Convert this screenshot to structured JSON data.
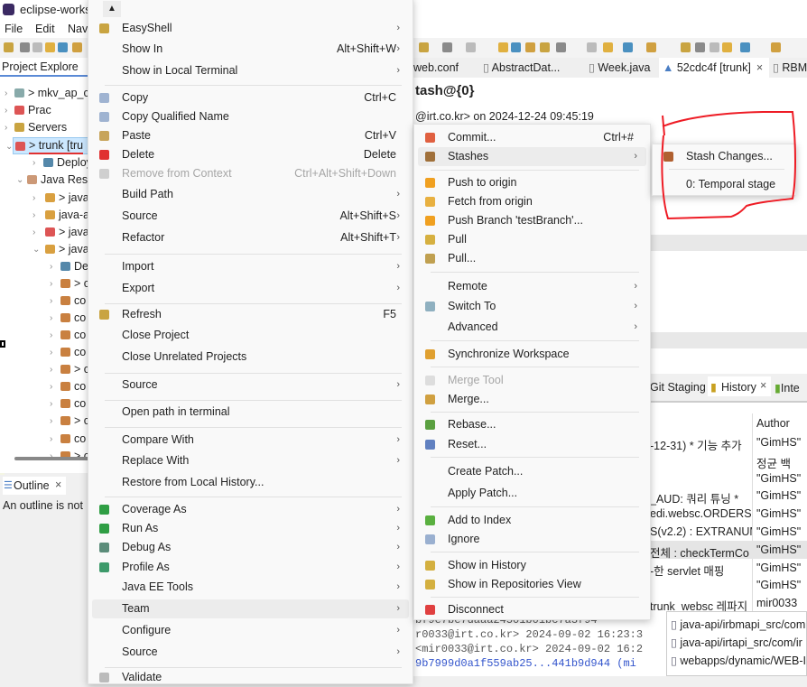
{
  "window": {
    "title": "eclipse-works"
  },
  "menubar": [
    "File",
    "Edit",
    "Nav"
  ],
  "project_explorer": {
    "tab": "Project Explore",
    "rows": [
      "> mkv_ap_c",
      "Prac",
      "Servers",
      "> trunk [tru",
      "Deploym",
      "Java Reso",
      "> java",
      "java-a",
      "> java",
      "> java",
      "De",
      "> c",
      "co",
      "co",
      "co",
      "co",
      "> c",
      "co",
      "co",
      "> c",
      "co",
      "> c"
    ]
  },
  "outline": {
    "tab": "Outline",
    "message": "An outline is not"
  },
  "editor": {
    "tabs": [
      "web.conf",
      "AbstractDat...",
      "Week.java",
      "52cdc4f [trunk]",
      "RBMT"
    ],
    "title": "tash@{0}",
    "author_line": "@irt.co.kr> on 2024-12-24 09:45:19"
  },
  "history": {
    "tabs": [
      "Git Staging",
      "History",
      "Inte"
    ],
    "author_header": "Author",
    "rows": [
      {
        "msg": "-12-31)  * 기능 추가",
        "author": "\"GimHS\""
      },
      {
        "msg": "",
        "author": "정균 백"
      },
      {
        "msg": "",
        "author": "\"GimHS\""
      },
      {
        "msg": "_AUD: 쿼리 튜닝   *",
        "author": "\"GimHS\""
      },
      {
        "msg": "edi.websc.ORDERSF",
        "author": "\"GimHS\""
      },
      {
        "msg": "S(v2.2) : EXTRANUM",
        "author": "\"GimHS\""
      },
      {
        "msg": "전체 : checkTermCo",
        "author": "\"GimHS\""
      },
      {
        "msg": "-한 servlet 매핑",
        "author": "\"GimHS\""
      },
      {
        "msg": "",
        "author": "\"GimHS\""
      },
      {
        "msg": "trunk_websc 레파지",
        "author": "mir0033"
      }
    ],
    "commit_text": [
      "bf9e7be7daaa24501b01bc7a3f94",
      "r0033@irt.co.kr> 2024-09-02 16:23:3",
      "<mir0033@irt.co.kr> 2024-09-02 16:2",
      "9b7999d0a1f559ab25...441b9d944 (mi"
    ],
    "files": [
      "java-api/irbmapi_src/com",
      "java-api/irtapi_src/com/ir",
      "webapps/dynamic/WEB-I"
    ]
  },
  "context_menu": {
    "items": [
      {
        "label": "EasyShell",
        "sub": true,
        "icon": "easyshell"
      },
      {
        "label": "Show In",
        "shortcut": "Alt+Shift+W",
        "sub": true
      },
      {
        "label": "Show in Local Terminal",
        "sub": true
      },
      {
        "label": "Copy",
        "shortcut": "Ctrl+C",
        "icon": "copy"
      },
      {
        "label": "Copy Qualified Name",
        "icon": "copy-qualified"
      },
      {
        "label": "Paste",
        "shortcut": "Ctrl+V",
        "icon": "paste"
      },
      {
        "label": "Delete",
        "shortcut": "Delete",
        "icon": "delete"
      },
      {
        "label": "Remove from Context",
        "shortcut": "Ctrl+Alt+Shift+Down",
        "icon": "remove-context",
        "disabled": true
      },
      {
        "label": "Build Path",
        "sub": true
      },
      {
        "label": "Source",
        "shortcut": "Alt+Shift+S",
        "sub": true
      },
      {
        "label": "Refactor",
        "shortcut": "Alt+Shift+T",
        "sub": true
      },
      {
        "label": "Import",
        "sub": true
      },
      {
        "label": "Export",
        "sub": true
      },
      {
        "label": "Refresh",
        "shortcut": "F5",
        "icon": "refresh"
      },
      {
        "label": "Close Project"
      },
      {
        "label": "Close Unrelated Projects"
      },
      {
        "label": "Source",
        "sub": true
      },
      {
        "label": "Open path in terminal"
      },
      {
        "label": "Compare With",
        "sub": true
      },
      {
        "label": "Replace With",
        "sub": true
      },
      {
        "label": "Restore from Local History..."
      },
      {
        "label": "Coverage As",
        "sub": true,
        "icon": "coverage"
      },
      {
        "label": "Run As",
        "sub": true,
        "icon": "run"
      },
      {
        "label": "Debug As",
        "sub": true,
        "icon": "debug"
      },
      {
        "label": "Profile As",
        "sub": true,
        "icon": "profile"
      },
      {
        "label": "Java EE Tools",
        "sub": true
      },
      {
        "label": "Team",
        "sub": true,
        "highlighted": true
      },
      {
        "label": "Configure",
        "sub": true
      },
      {
        "label": "Source",
        "sub": true
      },
      {
        "label": "Validate",
        "icon": "validate"
      }
    ]
  },
  "team_menu": {
    "items": [
      {
        "label": "Commit...",
        "shortcut": "Ctrl+#",
        "icon": "commit"
      },
      {
        "label": "Stashes",
        "sub": true,
        "icon": "stash",
        "highlighted": true
      },
      {
        "label": "Push to origin",
        "icon": "push"
      },
      {
        "label": "Fetch from origin",
        "icon": "fetch"
      },
      {
        "label": "Push Branch 'testBranch'...",
        "icon": "push-branch"
      },
      {
        "label": "Pull",
        "icon": "pull"
      },
      {
        "label": "Pull...",
        "icon": "pull-dialog"
      },
      {
        "label": "Remote",
        "sub": true
      },
      {
        "label": "Switch To",
        "sub": true,
        "icon": "switch"
      },
      {
        "label": "Advanced",
        "sub": true
      },
      {
        "label": "Synchronize Workspace",
        "icon": "synchronize"
      },
      {
        "label": "Merge Tool",
        "icon": "merge-tool",
        "disabled": true
      },
      {
        "label": "Merge...",
        "icon": "merge"
      },
      {
        "label": "Rebase...",
        "icon": "rebase"
      },
      {
        "label": "Reset...",
        "icon": "reset"
      },
      {
        "label": "Create Patch..."
      },
      {
        "label": "Apply Patch..."
      },
      {
        "label": "Add to Index",
        "icon": "add-index"
      },
      {
        "label": "Ignore",
        "icon": "ignore"
      },
      {
        "label": "Show in History",
        "icon": "history"
      },
      {
        "label": "Show in Repositories View",
        "icon": "repositories"
      },
      {
        "label": "Disconnect",
        "icon": "disconnect"
      }
    ]
  },
  "stash_menu": {
    "items": [
      {
        "label": "Stash Changes...",
        "icon": "stash-changes"
      },
      {
        "label": "0: Temporal stage"
      }
    ]
  },
  "colors": {
    "annotation": "#ee1c25",
    "selection": "#cce8ff",
    "menu_bg": "#f9f9f9"
  }
}
